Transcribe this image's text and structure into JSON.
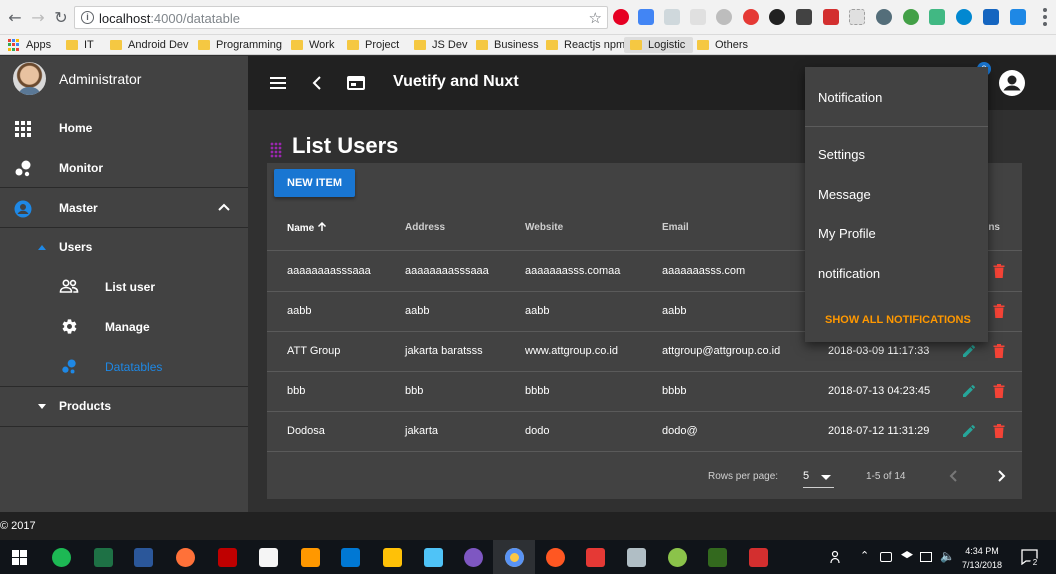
{
  "browser": {
    "url_host": "localhost",
    "url_path": ":4000/datatable",
    "bookmarks": [
      "Apps",
      "IT",
      "Android Dev",
      "Programming",
      "Work",
      "Project",
      "JS Dev",
      "Business",
      "Reactjs npm",
      "Logistic",
      "Others"
    ]
  },
  "sidebar": {
    "user_name": "Administrator",
    "items": [
      {
        "label": "Home",
        "icon": "apps-grid-icon"
      },
      {
        "label": "Monitor",
        "icon": "bubble-chart-icon"
      },
      {
        "label": "Master",
        "icon": "account-circle-icon",
        "expanded": true
      }
    ],
    "group_label": "Users",
    "sub_items": [
      {
        "label": "List user",
        "icon": "people-icon"
      },
      {
        "label": "Manage",
        "icon": "gear-icon"
      },
      {
        "label": "Datatables",
        "icon": "bubble-chart-icon",
        "active": true
      }
    ],
    "products_label": "Products"
  },
  "toolbar": {
    "title": "Vuetify and Nuxt",
    "notification_count": "2"
  },
  "page": {
    "title": "List Users",
    "new_item_label": "NEW ITEM"
  },
  "table": {
    "headers": {
      "name": "Name",
      "address": "Address",
      "website": "Website",
      "email": "Email",
      "actions": "Actions"
    },
    "rows": [
      {
        "name": "aaaaaaaasssaaa",
        "address": "aaaaaaaasssaaa",
        "website": "aaaaaaasss.comaa",
        "email": "aaaaaaasss.com",
        "date": ""
      },
      {
        "name": "aabb",
        "address": "aabb",
        "website": "aabb",
        "email": "aabb",
        "date": ""
      },
      {
        "name": "ATT Group",
        "address": "jakarta baratsss",
        "website": "www.attgroup.co.id",
        "email": "attgroup@attgroup.co.id",
        "date": "2018-03-09 11:17:33"
      },
      {
        "name": "bbb",
        "address": "bbb",
        "website": "bbbb",
        "email": "bbbb",
        "date": "2018-07-13 04:23:45"
      },
      {
        "name": "Dodosa",
        "address": "jakarta",
        "website": "dodo",
        "email": "dodo@",
        "date": "2018-07-12 11:31:29"
      }
    ],
    "rows_per_page_label": "Rows per page:",
    "rows_per_page_value": "5",
    "pagination_text": "1-5 of 14"
  },
  "notification_menu": {
    "header": "Notification",
    "items": [
      "Settings",
      "Message",
      "My Profile",
      "notification"
    ],
    "show_all_label": "SHOW ALL NOTIFICATIONS"
  },
  "footer": {
    "text": "© 2017"
  },
  "taskbar": {
    "time": "4:34 PM",
    "date": "7/13/2018",
    "notification_count": "2"
  },
  "colors": {
    "primary": "#1976d2",
    "accent": "#ff9800",
    "edit": "#26a69a",
    "delete": "#f44336",
    "active_nav": "#1e88e5"
  }
}
